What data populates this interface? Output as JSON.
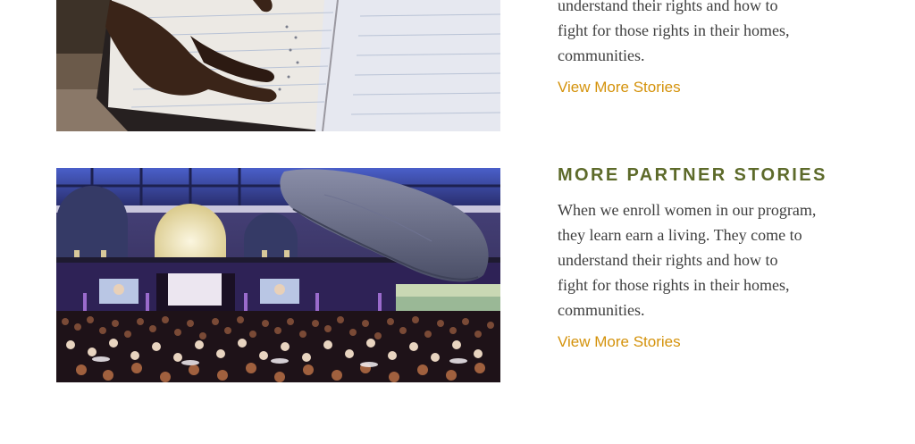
{
  "stories": [
    {
      "image_alt": "Hands tracing braille-like marks in a notebook",
      "text_lines": [
        "understand their rights and how to",
        "fight for those rights in their homes,",
        "communities."
      ],
      "link_label": "View More Stories"
    },
    {
      "heading": "MORE PARTNER STORIES",
      "image_alt": "Gala dinner under a whale model in a museum hall",
      "text_lines": [
        "When we enroll women in our program,",
        "they learn earn a living. They come to",
        "understand their rights and how to",
        "fight for those rights in their homes,",
        "communities."
      ],
      "link_label": "View More Stories"
    }
  ],
  "colors": {
    "heading": "#5d6a2a",
    "body_text": "#3e3e3e",
    "link": "#d4920b"
  }
}
